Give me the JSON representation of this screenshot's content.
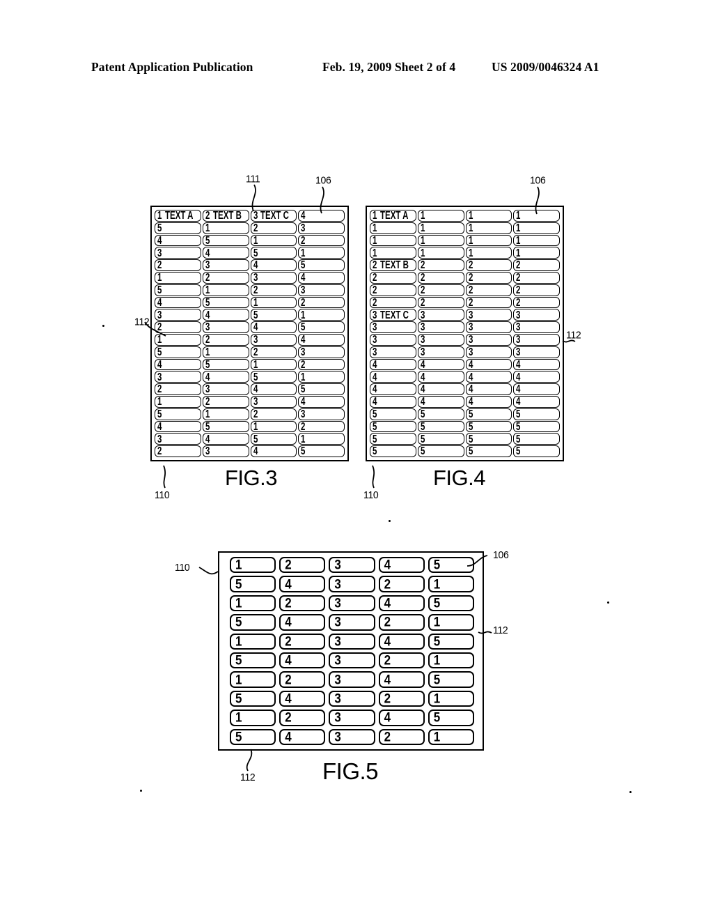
{
  "header": {
    "left": "Patent Application Publication",
    "middle": "Feb. 19, 2009  Sheet 2 of 4",
    "right": "US 2009/0046324 A1"
  },
  "figures": [
    {
      "id": "fig3",
      "caption": "FIG.3",
      "columns": 4,
      "rows": 20,
      "labels": [
        {
          "text": "111",
          "name": "ref-111"
        },
        {
          "text": "106",
          "name": "ref-106"
        },
        {
          "text": "112",
          "name": "ref-112"
        },
        {
          "text": "110",
          "name": "ref-110"
        }
      ],
      "cells": [
        [
          {
            "num": "1",
            "text": "TEXT A"
          },
          {
            "num": "2",
            "text": "TEXT B"
          },
          {
            "num": "3",
            "text": "TEXT C"
          },
          {
            "num": "4",
            "text": ""
          }
        ],
        [
          {
            "num": "5",
            "text": ""
          },
          {
            "num": "1",
            "text": ""
          },
          {
            "num": "2",
            "text": ""
          },
          {
            "num": "3",
            "text": ""
          }
        ],
        [
          {
            "num": "4",
            "text": ""
          },
          {
            "num": "5",
            "text": ""
          },
          {
            "num": "1",
            "text": ""
          },
          {
            "num": "2",
            "text": ""
          }
        ],
        [
          {
            "num": "3",
            "text": ""
          },
          {
            "num": "4",
            "text": ""
          },
          {
            "num": "5",
            "text": ""
          },
          {
            "num": "1",
            "text": ""
          }
        ],
        [
          {
            "num": "2",
            "text": ""
          },
          {
            "num": "3",
            "text": ""
          },
          {
            "num": "4",
            "text": ""
          },
          {
            "num": "5",
            "text": ""
          }
        ],
        [
          {
            "num": "1",
            "text": ""
          },
          {
            "num": "2",
            "text": ""
          },
          {
            "num": "3",
            "text": ""
          },
          {
            "num": "4",
            "text": ""
          }
        ],
        [
          {
            "num": "5",
            "text": ""
          },
          {
            "num": "1",
            "text": ""
          },
          {
            "num": "2",
            "text": ""
          },
          {
            "num": "3",
            "text": ""
          }
        ],
        [
          {
            "num": "4",
            "text": ""
          },
          {
            "num": "5",
            "text": ""
          },
          {
            "num": "1",
            "text": ""
          },
          {
            "num": "2",
            "text": ""
          }
        ],
        [
          {
            "num": "3",
            "text": ""
          },
          {
            "num": "4",
            "text": ""
          },
          {
            "num": "5",
            "text": ""
          },
          {
            "num": "1",
            "text": ""
          }
        ],
        [
          {
            "num": "2",
            "text": ""
          },
          {
            "num": "3",
            "text": ""
          },
          {
            "num": "4",
            "text": ""
          },
          {
            "num": "5",
            "text": ""
          }
        ],
        [
          {
            "num": "1",
            "text": ""
          },
          {
            "num": "2",
            "text": ""
          },
          {
            "num": "3",
            "text": ""
          },
          {
            "num": "4",
            "text": ""
          }
        ],
        [
          {
            "num": "5",
            "text": ""
          },
          {
            "num": "1",
            "text": ""
          },
          {
            "num": "2",
            "text": ""
          },
          {
            "num": "3",
            "text": ""
          }
        ],
        [
          {
            "num": "4",
            "text": ""
          },
          {
            "num": "5",
            "text": ""
          },
          {
            "num": "1",
            "text": ""
          },
          {
            "num": "2",
            "text": ""
          }
        ],
        [
          {
            "num": "3",
            "text": ""
          },
          {
            "num": "4",
            "text": ""
          },
          {
            "num": "5",
            "text": ""
          },
          {
            "num": "1",
            "text": ""
          }
        ],
        [
          {
            "num": "2",
            "text": ""
          },
          {
            "num": "3",
            "text": ""
          },
          {
            "num": "4",
            "text": ""
          },
          {
            "num": "5",
            "text": ""
          }
        ],
        [
          {
            "num": "1",
            "text": ""
          },
          {
            "num": "2",
            "text": ""
          },
          {
            "num": "3",
            "text": ""
          },
          {
            "num": "4",
            "text": ""
          }
        ],
        [
          {
            "num": "5",
            "text": ""
          },
          {
            "num": "1",
            "text": ""
          },
          {
            "num": "2",
            "text": ""
          },
          {
            "num": "3",
            "text": ""
          }
        ],
        [
          {
            "num": "4",
            "text": ""
          },
          {
            "num": "5",
            "text": ""
          },
          {
            "num": "1",
            "text": ""
          },
          {
            "num": "2",
            "text": ""
          }
        ],
        [
          {
            "num": "3",
            "text": ""
          },
          {
            "num": "4",
            "text": ""
          },
          {
            "num": "5",
            "text": ""
          },
          {
            "num": "1",
            "text": ""
          }
        ],
        [
          {
            "num": "2",
            "text": ""
          },
          {
            "num": "3",
            "text": ""
          },
          {
            "num": "4",
            "text": ""
          },
          {
            "num": "5",
            "text": ""
          }
        ]
      ]
    },
    {
      "id": "fig4",
      "caption": "FIG.4",
      "columns": 4,
      "rows": 20,
      "labels": [
        {
          "text": "106",
          "name": "ref-106"
        },
        {
          "text": "112",
          "name": "ref-112"
        },
        {
          "text": "110",
          "name": "ref-110"
        }
      ],
      "cells": [
        [
          {
            "num": "1",
            "text": "TEXT A"
          },
          {
            "num": "1",
            "text": ""
          },
          {
            "num": "1",
            "text": ""
          },
          {
            "num": "1",
            "text": ""
          }
        ],
        [
          {
            "num": "1",
            "text": ""
          },
          {
            "num": "1",
            "text": ""
          },
          {
            "num": "1",
            "text": ""
          },
          {
            "num": "1",
            "text": ""
          }
        ],
        [
          {
            "num": "1",
            "text": ""
          },
          {
            "num": "1",
            "text": ""
          },
          {
            "num": "1",
            "text": ""
          },
          {
            "num": "1",
            "text": ""
          }
        ],
        [
          {
            "num": "1",
            "text": ""
          },
          {
            "num": "1",
            "text": ""
          },
          {
            "num": "1",
            "text": ""
          },
          {
            "num": "1",
            "text": ""
          }
        ],
        [
          {
            "num": "2",
            "text": "TEXT B"
          },
          {
            "num": "2",
            "text": ""
          },
          {
            "num": "2",
            "text": ""
          },
          {
            "num": "2",
            "text": ""
          }
        ],
        [
          {
            "num": "2",
            "text": ""
          },
          {
            "num": "2",
            "text": ""
          },
          {
            "num": "2",
            "text": ""
          },
          {
            "num": "2",
            "text": ""
          }
        ],
        [
          {
            "num": "2",
            "text": ""
          },
          {
            "num": "2",
            "text": ""
          },
          {
            "num": "2",
            "text": ""
          },
          {
            "num": "2",
            "text": ""
          }
        ],
        [
          {
            "num": "2",
            "text": ""
          },
          {
            "num": "2",
            "text": ""
          },
          {
            "num": "2",
            "text": ""
          },
          {
            "num": "2",
            "text": ""
          }
        ],
        [
          {
            "num": "3",
            "text": "TEXT C"
          },
          {
            "num": "3",
            "text": ""
          },
          {
            "num": "3",
            "text": ""
          },
          {
            "num": "3",
            "text": ""
          }
        ],
        [
          {
            "num": "3",
            "text": ""
          },
          {
            "num": "3",
            "text": ""
          },
          {
            "num": "3",
            "text": ""
          },
          {
            "num": "3",
            "text": ""
          }
        ],
        [
          {
            "num": "3",
            "text": ""
          },
          {
            "num": "3",
            "text": ""
          },
          {
            "num": "3",
            "text": ""
          },
          {
            "num": "3",
            "text": ""
          }
        ],
        [
          {
            "num": "3",
            "text": ""
          },
          {
            "num": "3",
            "text": ""
          },
          {
            "num": "3",
            "text": ""
          },
          {
            "num": "3",
            "text": ""
          }
        ],
        [
          {
            "num": "4",
            "text": ""
          },
          {
            "num": "4",
            "text": ""
          },
          {
            "num": "4",
            "text": ""
          },
          {
            "num": "4",
            "text": ""
          }
        ],
        [
          {
            "num": "4",
            "text": ""
          },
          {
            "num": "4",
            "text": ""
          },
          {
            "num": "4",
            "text": ""
          },
          {
            "num": "4",
            "text": ""
          }
        ],
        [
          {
            "num": "4",
            "text": ""
          },
          {
            "num": "4",
            "text": ""
          },
          {
            "num": "4",
            "text": ""
          },
          {
            "num": "4",
            "text": ""
          }
        ],
        [
          {
            "num": "4",
            "text": ""
          },
          {
            "num": "4",
            "text": ""
          },
          {
            "num": "4",
            "text": ""
          },
          {
            "num": "4",
            "text": ""
          }
        ],
        [
          {
            "num": "5",
            "text": ""
          },
          {
            "num": "5",
            "text": ""
          },
          {
            "num": "5",
            "text": ""
          },
          {
            "num": "5",
            "text": ""
          }
        ],
        [
          {
            "num": "5",
            "text": ""
          },
          {
            "num": "5",
            "text": ""
          },
          {
            "num": "5",
            "text": ""
          },
          {
            "num": "5",
            "text": ""
          }
        ],
        [
          {
            "num": "5",
            "text": ""
          },
          {
            "num": "5",
            "text": ""
          },
          {
            "num": "5",
            "text": ""
          },
          {
            "num": "5",
            "text": ""
          }
        ],
        [
          {
            "num": "5",
            "text": ""
          },
          {
            "num": "5",
            "text": ""
          },
          {
            "num": "5",
            "text": ""
          },
          {
            "num": "5",
            "text": ""
          }
        ]
      ]
    },
    {
      "id": "fig5",
      "caption": "FIG.5",
      "columns": 5,
      "rows": 10,
      "labels": [
        {
          "text": "110",
          "name": "ref-110"
        },
        {
          "text": "106",
          "name": "ref-106"
        },
        {
          "text": "112",
          "name": "ref-112-right"
        },
        {
          "text": "112",
          "name": "ref-112-bottom"
        }
      ],
      "cells": [
        [
          {
            "num": "1",
            "text": ""
          },
          {
            "num": "2",
            "text": ""
          },
          {
            "num": "3",
            "text": ""
          },
          {
            "num": "4",
            "text": ""
          },
          {
            "num": "5",
            "text": ""
          }
        ],
        [
          {
            "num": "5",
            "text": ""
          },
          {
            "num": "4",
            "text": ""
          },
          {
            "num": "3",
            "text": ""
          },
          {
            "num": "2",
            "text": ""
          },
          {
            "num": "1",
            "text": ""
          }
        ],
        [
          {
            "num": "1",
            "text": ""
          },
          {
            "num": "2",
            "text": ""
          },
          {
            "num": "3",
            "text": ""
          },
          {
            "num": "4",
            "text": ""
          },
          {
            "num": "5",
            "text": ""
          }
        ],
        [
          {
            "num": "5",
            "text": ""
          },
          {
            "num": "4",
            "text": ""
          },
          {
            "num": "3",
            "text": ""
          },
          {
            "num": "2",
            "text": ""
          },
          {
            "num": "1",
            "text": ""
          }
        ],
        [
          {
            "num": "1",
            "text": ""
          },
          {
            "num": "2",
            "text": ""
          },
          {
            "num": "3",
            "text": ""
          },
          {
            "num": "4",
            "text": ""
          },
          {
            "num": "5",
            "text": ""
          }
        ],
        [
          {
            "num": "5",
            "text": ""
          },
          {
            "num": "4",
            "text": ""
          },
          {
            "num": "3",
            "text": ""
          },
          {
            "num": "2",
            "text": ""
          },
          {
            "num": "1",
            "text": ""
          }
        ],
        [
          {
            "num": "1",
            "text": ""
          },
          {
            "num": "2",
            "text": ""
          },
          {
            "num": "3",
            "text": ""
          },
          {
            "num": "4",
            "text": ""
          },
          {
            "num": "5",
            "text": ""
          }
        ],
        [
          {
            "num": "5",
            "text": ""
          },
          {
            "num": "4",
            "text": ""
          },
          {
            "num": "3",
            "text": ""
          },
          {
            "num": "2",
            "text": ""
          },
          {
            "num": "1",
            "text": ""
          }
        ],
        [
          {
            "num": "1",
            "text": ""
          },
          {
            "num": "2",
            "text": ""
          },
          {
            "num": "3",
            "text": ""
          },
          {
            "num": "4",
            "text": ""
          },
          {
            "num": "5",
            "text": ""
          }
        ],
        [
          {
            "num": "5",
            "text": ""
          },
          {
            "num": "4",
            "text": ""
          },
          {
            "num": "3",
            "text": ""
          },
          {
            "num": "2",
            "text": ""
          },
          {
            "num": "1",
            "text": ""
          }
        ]
      ]
    }
  ],
  "ref_numerals": {
    "fig3_111": "111",
    "fig3_106": "106",
    "fig3_112": "112",
    "fig3_110": "110",
    "fig4_106": "106",
    "fig4_112": "112",
    "fig4_110": "110",
    "fig5_110": "110",
    "fig5_106": "106",
    "fig5_112_right": "112",
    "fig5_112_bottom": "112"
  },
  "captions": {
    "fig3": "FIG.3",
    "fig4": "FIG.4",
    "fig5": "FIG.5"
  }
}
